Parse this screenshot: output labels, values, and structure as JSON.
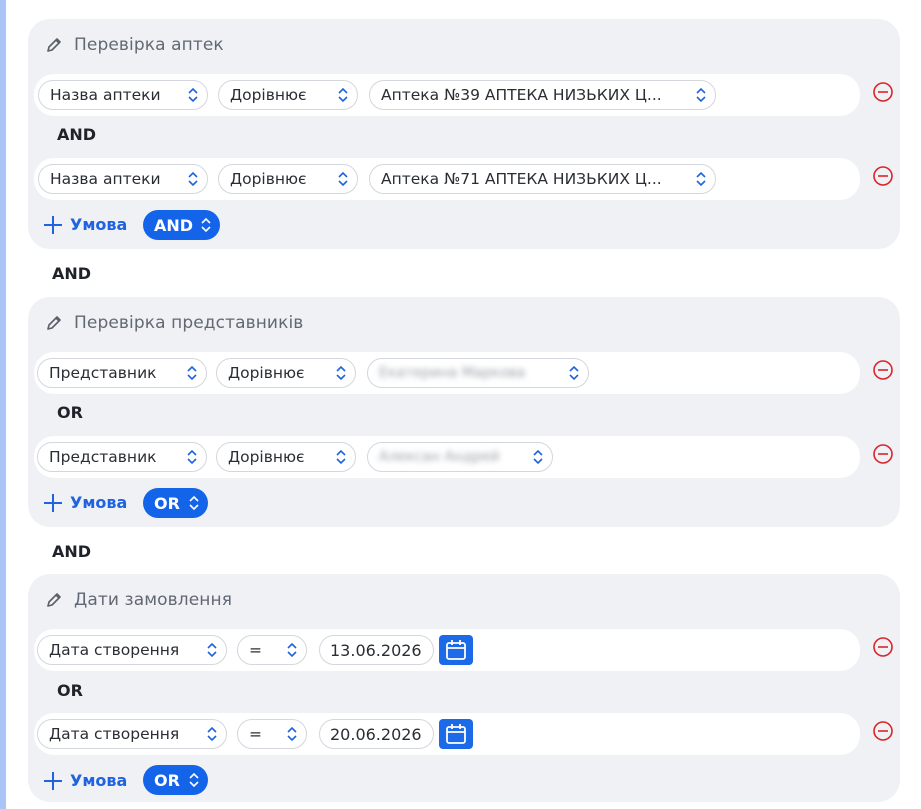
{
  "groups": [
    {
      "title": "Перевірка аптек",
      "rows": [
        {
          "field": "Назва аптеки",
          "operator": "Дорівнює",
          "value": "Аптека №39 АПТЕКА НИЗЬКИХ Ц..."
        },
        {
          "field": "Назва аптеки",
          "operator": "Дорівнює",
          "value": "Аптека №71 АПТЕКА НИЗЬКИХ Ц..."
        }
      ],
      "inner_joiner": "AND",
      "add_label": "Умова",
      "logic": "AND"
    },
    {
      "title": "Перевірка представників",
      "rows": [
        {
          "field": "Представник",
          "operator": "Дорівнює",
          "value": "Екатерина Маркова"
        },
        {
          "field": "Представник",
          "operator": "Дорівнює",
          "value": "Алексан Андрей"
        }
      ],
      "inner_joiner": "OR",
      "add_label": "Умова",
      "logic": "OR"
    },
    {
      "title": "Дати замовлення",
      "rows": [
        {
          "field": "Дата створення",
          "operator": "=",
          "value": "13.06.2026"
        },
        {
          "field": "Дата створення",
          "operator": "=",
          "value": "20.06.2026"
        }
      ],
      "inner_joiner": "OR",
      "add_label": "Умова",
      "logic": "OR"
    }
  ],
  "between_groups": [
    "AND",
    "AND"
  ],
  "colors": {
    "accent": "#1464ea",
    "remove": "#d9252b",
    "group_bg": "#eff1f5",
    "rail": "#a9c4f5"
  },
  "icons": [
    "pencil-icon",
    "chevron-up-down-icon",
    "remove-circle-icon",
    "plus-icon",
    "calendar-icon"
  ]
}
